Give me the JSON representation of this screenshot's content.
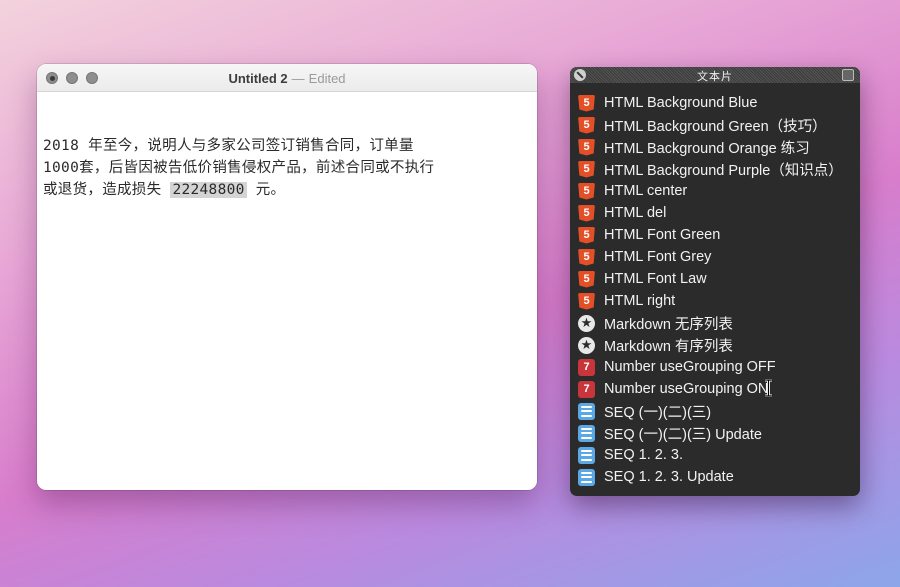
{
  "window": {
    "title": "Untitled 2",
    "separator": "—",
    "status": "Edited",
    "document": {
      "line1": "2018 年至今，说明人与多家公司签订销售合同，订单量",
      "line2": "1000套，后皆因被告低价销售侵权产品，前述合同或不执行",
      "line3_pre": "或退货，造成损失 ",
      "amount": "22248800",
      "line3_post": " 元。"
    }
  },
  "panel": {
    "title": "文本片",
    "items": [
      {
        "icon": "html5-icon",
        "label": "HTML Background Blue"
      },
      {
        "icon": "html5-icon",
        "label": "HTML Background Green（技巧）"
      },
      {
        "icon": "html5-icon",
        "label": "HTML Background Orange 练习"
      },
      {
        "icon": "html5-icon",
        "label": "HTML Background Purple（知识点）"
      },
      {
        "icon": "html5-icon",
        "label": "HTML center"
      },
      {
        "icon": "html5-icon",
        "label": "HTML del"
      },
      {
        "icon": "html5-icon",
        "label": "HTML Font Green"
      },
      {
        "icon": "html5-icon",
        "label": "HTML Font Grey"
      },
      {
        "icon": "html5-icon",
        "label": "HTML Font Law"
      },
      {
        "icon": "html5-icon",
        "label": "HTML right"
      },
      {
        "icon": "markdown-star-icon",
        "label": "Markdown 无序列表"
      },
      {
        "icon": "markdown-star-icon",
        "label": "Markdown 有序列表"
      },
      {
        "icon": "number-7-icon",
        "label": "Number useGrouping OFF"
      },
      {
        "icon": "number-7-icon",
        "label": "Number useGrouping ON"
      },
      {
        "icon": "list-icon",
        "label": "SEQ (一)(二)(三)"
      },
      {
        "icon": "list-icon",
        "label": "SEQ (一)(二)(三) Update"
      },
      {
        "icon": "list-icon",
        "label": "SEQ 1. 2. 3."
      },
      {
        "icon": "list-icon",
        "label": "SEQ 1. 2. 3. Update"
      }
    ]
  }
}
